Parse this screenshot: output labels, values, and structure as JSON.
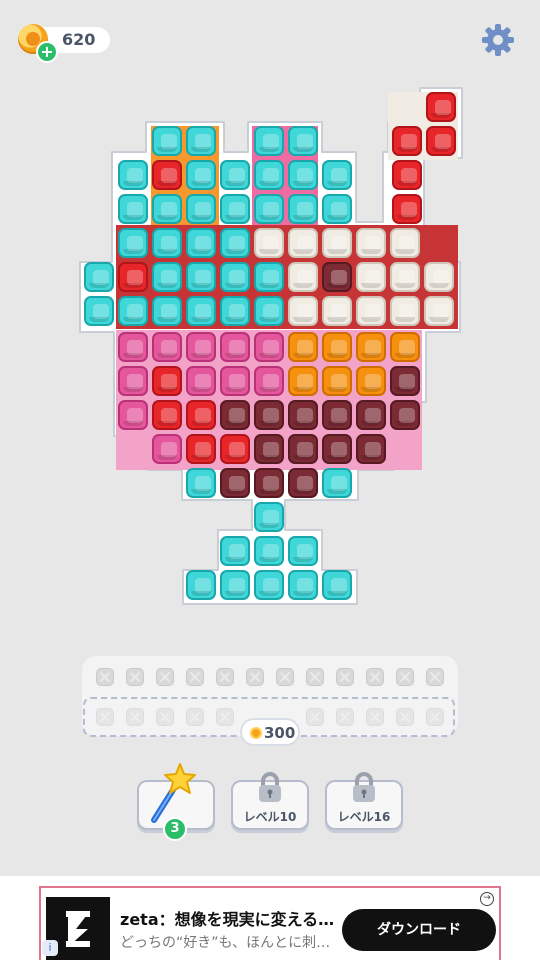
{
  "hud": {
    "coins": "620",
    "coin_icon": "coin-icon",
    "add_icon": "plus-icon",
    "settings_icon": "gear-icon"
  },
  "board": {
    "colors": {
      "cyan": "#3fd7d8",
      "red": "#e8262a",
      "maroon": "#7c2b35",
      "white": "#f1ece3",
      "pink": "#e5579c",
      "orange": "#f6900f"
    }
  },
  "tray": {
    "slots": 12,
    "extra_slots_unlock_cost": "300"
  },
  "boosters": [
    {
      "name": "magic-wand",
      "count": "3",
      "icon": "magic-wand-icon"
    },
    {
      "name": "locked-booster-1",
      "label": "レベル10",
      "icon": "lock-icon"
    },
    {
      "name": "locked-booster-2",
      "label": "レベル16",
      "icon": "lock-icon"
    }
  ],
  "ad": {
    "title": "zeta：想像を現実に変える…",
    "subtitle": "どっちの“好き”も、ほんとに刺…",
    "cta": "ダウンロード"
  }
}
